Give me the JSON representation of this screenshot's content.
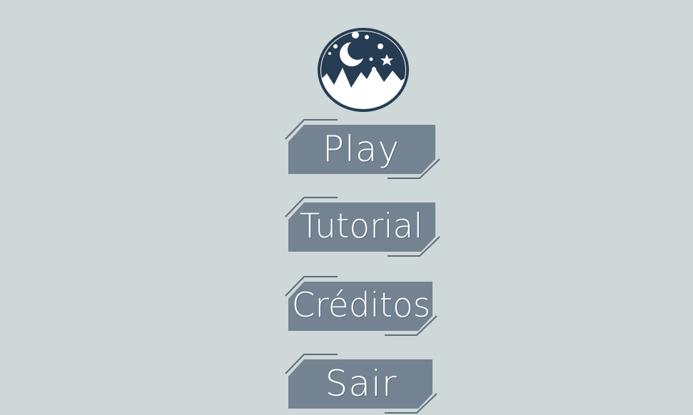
{
  "menu": {
    "items": [
      {
        "label": "Play"
      },
      {
        "label": "Tutorial"
      },
      {
        "label": "Créditos"
      },
      {
        "label": "Sair"
      }
    ]
  },
  "colors": {
    "background": "#cfd8d8",
    "button_fill": "#738392",
    "button_outline": "#5b6b7b",
    "logo_dark": "#263c52",
    "text": "#ffffff"
  },
  "icons": {
    "logo": "night-mountain-moon-icon"
  }
}
